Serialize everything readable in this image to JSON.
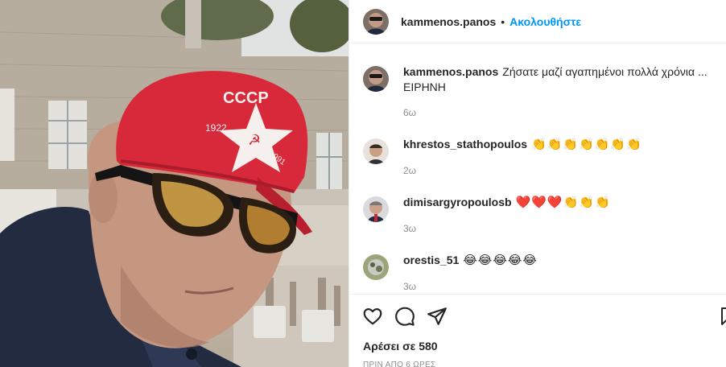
{
  "post": {
    "author": "kammenos.panos",
    "dot": "•",
    "follow_label": "Ακολουθήστε",
    "caption": {
      "username": "kammenos.panos",
      "text_line1": "Ζήσατε μαζί αγαπημένοι πολλά χρόνια ...",
      "text_line2": "ΕΙΡΗΝΗ",
      "time": "6ω"
    },
    "photo": {
      "cap_text": "CCCP",
      "cap_years_left": "1922",
      "cap_years_right": "1991"
    }
  },
  "comments": [
    {
      "username": "khrestos_stathopoulos",
      "text": "👏👏👏👏👏👏👏",
      "time": "2ω"
    },
    {
      "username": "dimisargyropoulosb",
      "text": "❤️❤️❤️👏👏👏",
      "time": "3ω"
    },
    {
      "username": "orestis_51",
      "text": "😂😂😂😂😂",
      "time": "3ω"
    }
  ],
  "actions": {
    "icons": [
      "heart-icon",
      "comment-icon",
      "share-icon",
      "bookmark-icon"
    ],
    "likes": "Αρέσει σε 580",
    "time_ago": "ΠΡΙΝ ΑΠΟ 6 ΩΡΕΣ"
  },
  "colors": {
    "accent": "#0095f6",
    "text": "#262626",
    "muted": "#8e8e8e",
    "cap": "#d8293a"
  }
}
